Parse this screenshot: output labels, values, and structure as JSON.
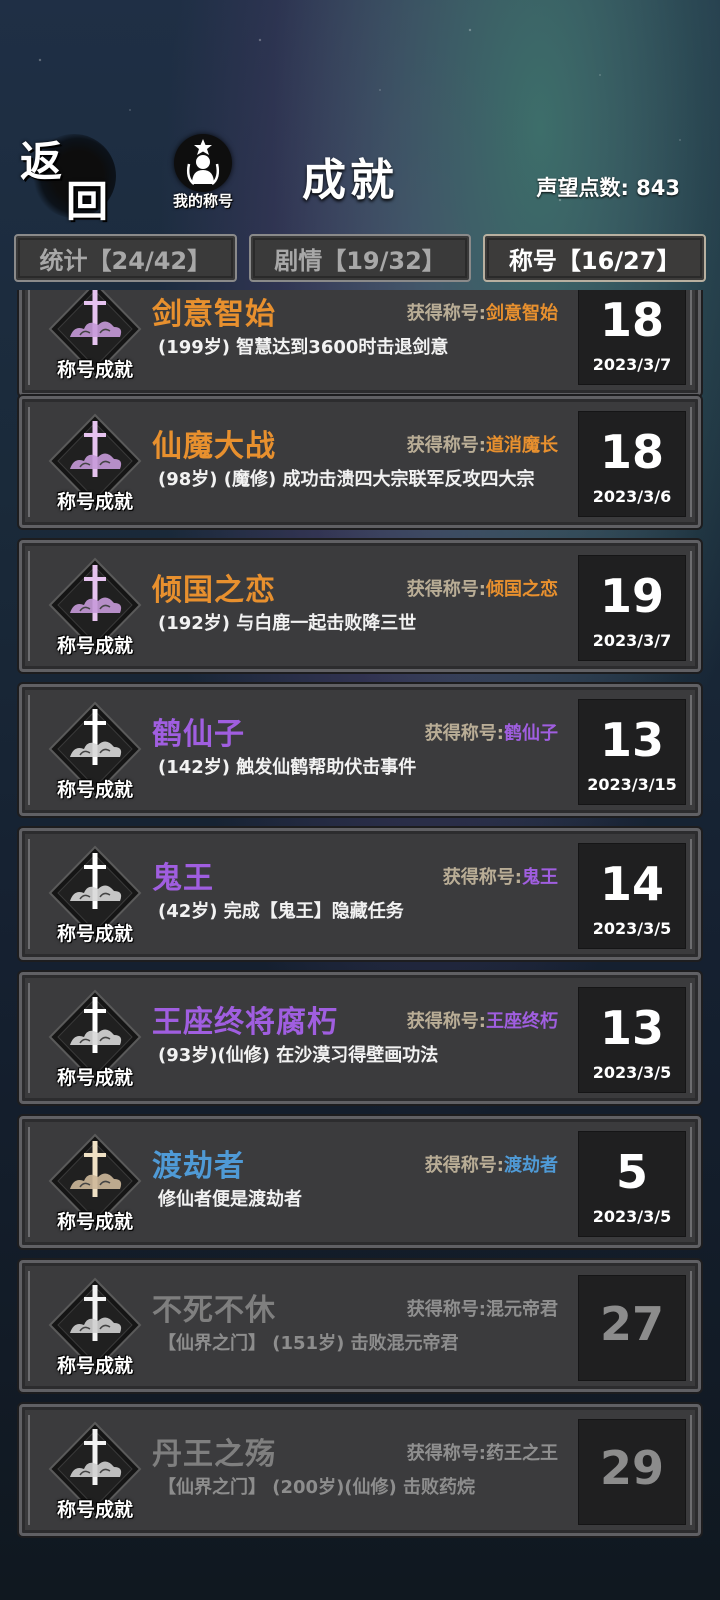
{
  "header": {
    "back_label_top": "返",
    "back_label_bottom": "回",
    "my_titles_label": "我的称号",
    "page_title": "成就",
    "prestige_label": "声望点数: 843"
  },
  "tabs": [
    {
      "label": "统计【24/42】",
      "active": false
    },
    {
      "label": "剧情【19/32】",
      "active": false
    },
    {
      "label": "称号【16/27】",
      "active": true
    }
  ],
  "badge_label": "称号成就",
  "reward_prefix": "获得称号:",
  "colors": {
    "orange": "#e8902e",
    "purple": "#a05ee0",
    "blue": "#4f9ad6",
    "gray": "#7f7f7f"
  },
  "achievements": [
    {
      "name": "剑意智始",
      "reward": "剑意智始",
      "desc": "(199岁) 智慧达到3600时击退剑意",
      "points": "18",
      "date": "2023/3/7",
      "color": "#e8902e",
      "badge": "pink",
      "locked": false
    },
    {
      "name": "仙魔大战",
      "reward": "道消魔长",
      "desc": "(98岁) (魔修) 成功击溃四大宗联军反攻四大宗",
      "points": "18",
      "date": "2023/3/6",
      "color": "#e8902e",
      "badge": "pink",
      "locked": false
    },
    {
      "name": "倾国之恋",
      "reward": "倾国之恋",
      "desc": "(192岁) 与白鹿一起击败降三世",
      "points": "19",
      "date": "2023/3/7",
      "color": "#e8902e",
      "badge": "pink",
      "locked": false
    },
    {
      "name": "鹤仙子",
      "reward": "鹤仙子",
      "desc": "(142岁) 触发仙鹤帮助伏击事件",
      "points": "13",
      "date": "2023/3/15",
      "color": "#a05ee0",
      "badge": "white",
      "locked": false
    },
    {
      "name": "鬼王",
      "reward": "鬼王",
      "desc": "(42岁) 完成【鬼王】隐藏任务",
      "points": "14",
      "date": "2023/3/5",
      "color": "#a05ee0",
      "badge": "white",
      "locked": false
    },
    {
      "name": "王座终将腐朽",
      "reward": "王座终朽",
      "desc": "(93岁)(仙修) 在沙漠习得壁画功法",
      "points": "13",
      "date": "2023/3/5",
      "color": "#a05ee0",
      "badge": "white",
      "locked": false
    },
    {
      "name": "渡劫者",
      "reward": "渡劫者",
      "desc": "修仙者便是渡劫者",
      "points": "5",
      "date": "2023/3/5",
      "color": "#4f9ad6",
      "badge": "gold",
      "locked": false
    },
    {
      "name": "不死不休",
      "reward": "混元帝君",
      "desc": "【仙界之门】 (151岁) 击败混元帝君",
      "points": "27",
      "date": "",
      "color": "#7f7f7f",
      "badge": "gray",
      "locked": true
    },
    {
      "name": "丹王之殇",
      "reward": "药王之王",
      "desc": "【仙界之门】 (200岁)(仙修) 击败药烷",
      "points": "29",
      "date": "",
      "color": "#7f7f7f",
      "badge": "gray",
      "locked": true
    }
  ]
}
